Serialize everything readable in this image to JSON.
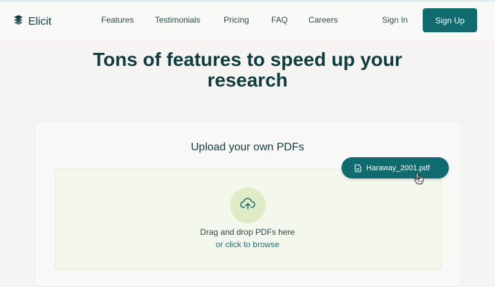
{
  "nav": {
    "brand": "Elicit",
    "links": [
      "Features",
      "Testimonials",
      "Pricing",
      "FAQ",
      "Careers"
    ],
    "sign_in": "Sign In",
    "sign_up": "Sign Up"
  },
  "hero": {
    "title_line1": "Tons of features to speed up your",
    "title_line2": "research"
  },
  "upload": {
    "title": "Upload your own PDFs",
    "drop_text": "Drag and drop PDFs here",
    "browse_text": "or click to browse",
    "dragged_file": "Haraway_2001.pdf"
  },
  "icons": {
    "logo": "elicit-logo-icon",
    "upload": "cloud-upload-icon",
    "file": "file-icon",
    "cursor": "hand-cursor-icon"
  },
  "colors": {
    "accent": "#0f6b6e",
    "dropzone_bg": "#f3f7ec",
    "upload_circle": "#dfeac7",
    "heading": "#0f3d3e"
  }
}
